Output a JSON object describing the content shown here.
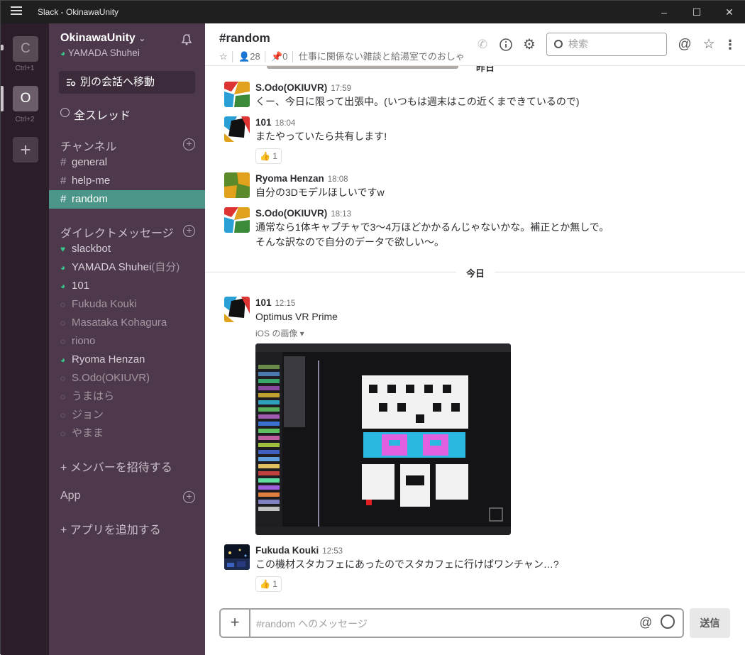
{
  "window": {
    "title": "Slack - OkinawaUnity"
  },
  "workspaces": [
    {
      "letter": "C",
      "shortcut": "Ctrl+1"
    },
    {
      "letter": "O",
      "shortcut": "Ctrl+2"
    }
  ],
  "sidebar": {
    "team": "OkinawaUnity",
    "team_caret": "⌄",
    "user": "YAMADA Shuhei",
    "jump": "別の会話へ移動",
    "all_threads": "全スレッド",
    "channels_header": "チャンネル",
    "channels": [
      "general",
      "help-me",
      "random"
    ],
    "dm_header": "ダイレクトメッセージ",
    "dms": [
      {
        "name": "slackbot",
        "status": "bot"
      },
      {
        "name": "YAMADA Shuhei",
        "suffix": "(自分)",
        "status": "on"
      },
      {
        "name": "101",
        "status": "on"
      },
      {
        "name": "Fukuda Kouki",
        "status": "off"
      },
      {
        "name": "Masataka Kohagura",
        "status": "off"
      },
      {
        "name": "riono",
        "status": "off"
      },
      {
        "name": "Ryoma Henzan",
        "status": "on"
      },
      {
        "name": "S.Odo(OKIUVR)",
        "status": "off"
      },
      {
        "name": "うまはら",
        "status": "off"
      },
      {
        "name": "ジョン",
        "status": "off"
      },
      {
        "name": "やまま",
        "status": "off"
      }
    ],
    "invite": "+ メンバーを招待する",
    "app_header": "App",
    "add_app": "+ アプリを追加する"
  },
  "channel": {
    "name": "#random",
    "members": "28",
    "pins": "0",
    "topic": "仕事に関係ない雑談と給湯室でのおしゃ",
    "search_placeholder": "検索"
  },
  "days": {
    "yesterday": "昨日",
    "today": "今日"
  },
  "messages": [
    {
      "author": "S.Odo(OKIUVR)",
      "time": "17:59",
      "lines": [
        "くー、今日に限って出張中。(いつもは週末はこの近くまできているので)"
      ]
    },
    {
      "author": "101",
      "time": "18:04",
      "lines": [
        "またやっていたら共有します!"
      ],
      "reaction": "👍 1"
    },
    {
      "author": "Ryoma Henzan",
      "time": "18:08",
      "lines": [
        "自分の3Dモデルほしいですw"
      ]
    },
    {
      "author": "S.Odo(OKIUVR)",
      "time": "18:13",
      "lines": [
        "通常なら1体キャプチャで3〜4万ほどかかるんじゃないかな。補正とか無しで。",
        "そんな訳なので自分のデータで欲しい〜。"
      ]
    },
    {
      "author": "101",
      "time": "12:15",
      "lines": [
        "Optimus VR Prime"
      ],
      "attachment": "iOS の画像 ▾"
    },
    {
      "author": "Fukuda Kouki",
      "time": "12:53",
      "lines": [
        "この機材スタカフェにあったのでスタカフェに行けばワンチャン…?"
      ],
      "reaction": "👍 1"
    }
  ],
  "composer": {
    "placeholder": "#random へのメッセージ",
    "send": "送信"
  }
}
